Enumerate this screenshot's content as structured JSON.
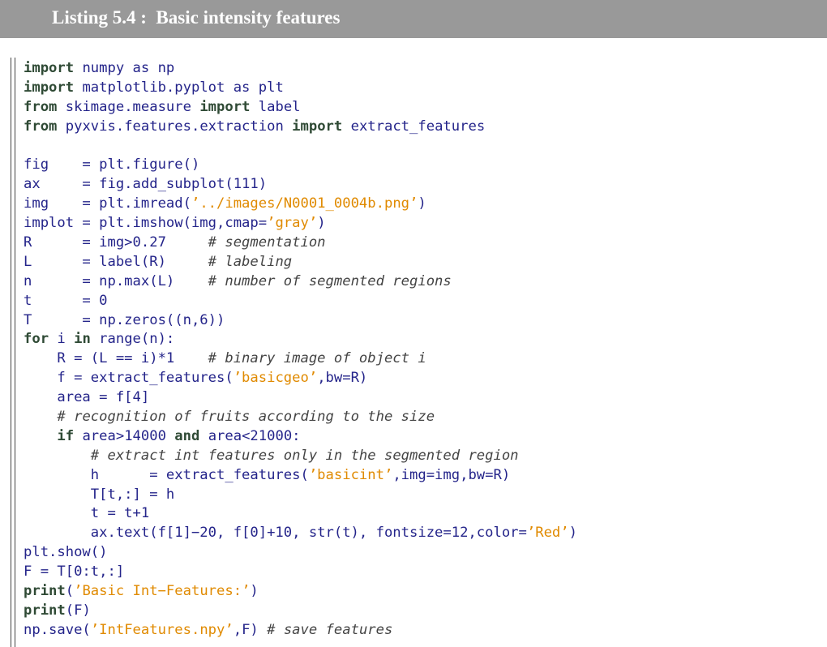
{
  "header": {
    "title": "Listing 5.4 :  Basic intensity features"
  },
  "code": {
    "language": "python",
    "lines": [
      [
        {
          "t": "import",
          "c": "kw"
        },
        {
          "t": " numpy as np",
          "c": "id"
        }
      ],
      [
        {
          "t": "import",
          "c": "kw"
        },
        {
          "t": " matplotlib.pyplot as plt",
          "c": "id"
        }
      ],
      [
        {
          "t": "from",
          "c": "kw"
        },
        {
          "t": " skimage.measure ",
          "c": "id"
        },
        {
          "t": "import",
          "c": "kw"
        },
        {
          "t": " label",
          "c": "id"
        }
      ],
      [
        {
          "t": "from",
          "c": "kw"
        },
        {
          "t": " pyxvis.features.extraction ",
          "c": "id"
        },
        {
          "t": "import",
          "c": "kw"
        },
        {
          "t": " extract_features",
          "c": "id"
        }
      ],
      [],
      [
        {
          "t": "fig    = plt.figure()",
          "c": "id"
        }
      ],
      [
        {
          "t": "ax     = fig.add_subplot(111)",
          "c": "id"
        }
      ],
      [
        {
          "t": "img    = plt.imread(",
          "c": "id"
        },
        {
          "t": "’../images/N0001_0004b.png’",
          "c": "str"
        },
        {
          "t": ")",
          "c": "id"
        }
      ],
      [
        {
          "t": "implot = plt.imshow(img,cmap=",
          "c": "id"
        },
        {
          "t": "’gray’",
          "c": "str"
        },
        {
          "t": ")",
          "c": "id"
        }
      ],
      [
        {
          "t": "R      = img>0.27     ",
          "c": "id"
        },
        {
          "t": "# segmentation",
          "c": "com"
        }
      ],
      [
        {
          "t": "L      = label(R)     ",
          "c": "id"
        },
        {
          "t": "# labeling",
          "c": "com"
        }
      ],
      [
        {
          "t": "n      = np.max(L)    ",
          "c": "id"
        },
        {
          "t": "# number of segmented regions",
          "c": "com"
        }
      ],
      [
        {
          "t": "t      = 0",
          "c": "id"
        }
      ],
      [
        {
          "t": "T      = np.zeros((n,6))",
          "c": "id"
        }
      ],
      [
        {
          "t": "for",
          "c": "kw"
        },
        {
          "t": " i ",
          "c": "id"
        },
        {
          "t": "in",
          "c": "kw"
        },
        {
          "t": " range(n):",
          "c": "id"
        }
      ],
      [
        {
          "t": "    R = (L == i)*1    ",
          "c": "id"
        },
        {
          "t": "# binary image of object i",
          "c": "com"
        }
      ],
      [
        {
          "t": "    f = extract_features(",
          "c": "id"
        },
        {
          "t": "’basicgeo’",
          "c": "str"
        },
        {
          "t": ",bw=R)",
          "c": "id"
        }
      ],
      [
        {
          "t": "    area = f[4]",
          "c": "id"
        }
      ],
      [
        {
          "t": "    ",
          "c": "id"
        },
        {
          "t": "# recognition of fruits according to the size",
          "c": "com"
        }
      ],
      [
        {
          "t": "    ",
          "c": "id"
        },
        {
          "t": "if",
          "c": "kw"
        },
        {
          "t": " area>14000 ",
          "c": "id"
        },
        {
          "t": "and",
          "c": "kw"
        },
        {
          "t": " area<21000:",
          "c": "id"
        }
      ],
      [
        {
          "t": "        ",
          "c": "id"
        },
        {
          "t": "# extract int features only in the segmented region",
          "c": "com"
        }
      ],
      [
        {
          "t": "        h      = extract_features(",
          "c": "id"
        },
        {
          "t": "’basicint’",
          "c": "str"
        },
        {
          "t": ",img=img,bw=R)",
          "c": "id"
        }
      ],
      [
        {
          "t": "        T[t,:] = h",
          "c": "id"
        }
      ],
      [
        {
          "t": "        t = t+1",
          "c": "id"
        }
      ],
      [
        {
          "t": "        ax.text(f[1]−20, f[0]+10, str(t), fontsize=12,color=",
          "c": "id"
        },
        {
          "t": "’Red’",
          "c": "str"
        },
        {
          "t": ")",
          "c": "id"
        }
      ],
      [
        {
          "t": "plt.show()",
          "c": "id"
        }
      ],
      [
        {
          "t": "F = T[0:t,:]",
          "c": "id"
        }
      ],
      [
        {
          "t": "print",
          "c": "kw"
        },
        {
          "t": "(",
          "c": "id"
        },
        {
          "t": "’Basic Int−Features:’",
          "c": "str"
        },
        {
          "t": ")",
          "c": "id"
        }
      ],
      [
        {
          "t": "print",
          "c": "kw"
        },
        {
          "t": "(F)",
          "c": "id"
        }
      ],
      [
        {
          "t": "np.save(",
          "c": "id"
        },
        {
          "t": "’IntFeatures.npy’",
          "c": "str"
        },
        {
          "t": ",F) ",
          "c": "id"
        },
        {
          "t": "# save features",
          "c": "com"
        }
      ]
    ]
  },
  "colors": {
    "header_bg": "#999999",
    "header_text": "#ffffff",
    "identifier": "#24248a",
    "keyword": "#2f4a35",
    "string": "#e08a00",
    "comment": "#444444"
  }
}
